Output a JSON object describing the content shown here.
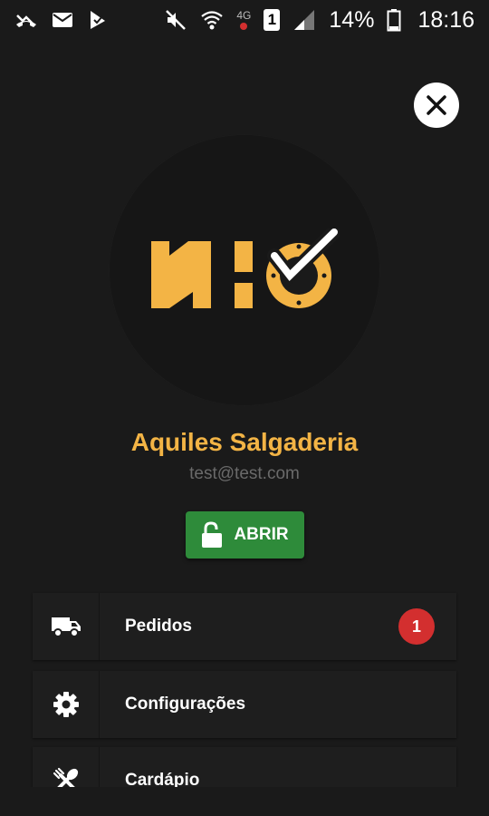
{
  "status_bar": {
    "network_label": "4G",
    "sim_label": "1",
    "battery_percent": "14%",
    "time": "18:16",
    "icons": [
      "missed-call-icon",
      "mail-icon",
      "app-notification-icon",
      "mute-icon",
      "wifi-icon",
      "signal-icon",
      "battery-icon"
    ]
  },
  "profile": {
    "name": "Aquiles Salgaderia",
    "email": "test@test.com",
    "logo_text": "NHO"
  },
  "status_button": {
    "label": "ABRIR",
    "color": "#2e8b3a"
  },
  "menu": {
    "items": [
      {
        "label": "Pedidos",
        "icon": "delivery-truck-icon",
        "badge": "1"
      },
      {
        "label": "Configurações",
        "icon": "gear-icon"
      },
      {
        "label": "Cardápio",
        "icon": "utensils-icon"
      }
    ]
  },
  "colors": {
    "accent": "#f3b445",
    "badge": "#d32f2f",
    "background": "#1a1a1a"
  }
}
